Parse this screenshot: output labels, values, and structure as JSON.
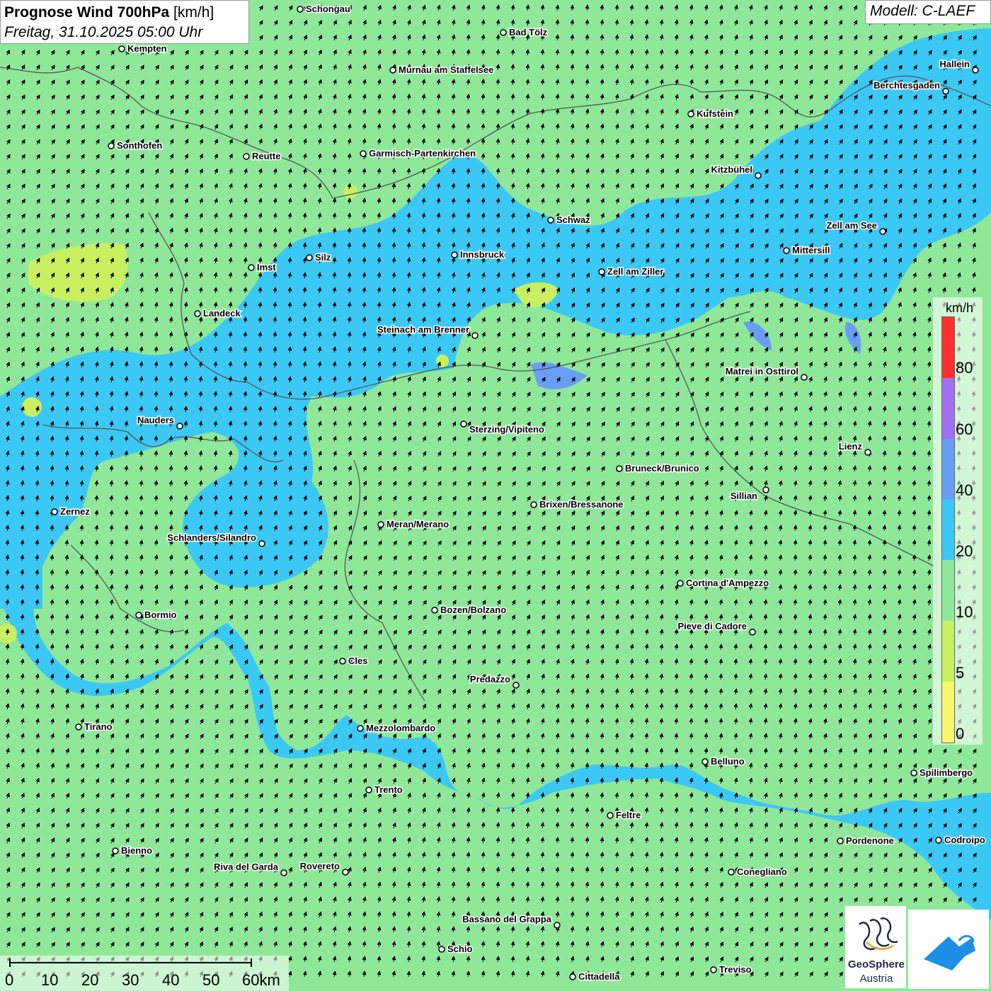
{
  "title": {
    "main": "Prognose Wind 700hPa",
    "unit": "[km/h]",
    "datetime": "Freitag, 31.10.2025 05:00 Uhr"
  },
  "model": "Modell: C-LAEF",
  "legend": {
    "unit": "km/h",
    "labels": [
      "80",
      "60",
      "40",
      "20",
      "10",
      "5",
      "0"
    ],
    "colors": [
      "#ff3030",
      "#a070f0",
      "#6a9ef5",
      "#3cc8f5",
      "#8fe89a",
      "#c8f060",
      "#f8f870"
    ]
  },
  "scale": {
    "labels": [
      "0",
      "10",
      "20",
      "30",
      "40",
      "50",
      "60km"
    ]
  },
  "logo": {
    "name": "GeoSphere",
    "sub": "Austria"
  },
  "wind": {
    "direction": "south-southwest to north-northeast",
    "dominant_speed_band": "10-20 km/h over the Alps"
  },
  "cities": [
    {
      "name": "Schongau"
    },
    {
      "name": "Bad Tölz"
    },
    {
      "name": "Kempten"
    },
    {
      "name": "Murnau am Staffelsee"
    },
    {
      "name": "Hallein"
    },
    {
      "name": "Berchtesgaden"
    },
    {
      "name": "Kufstein"
    },
    {
      "name": "Sonthofen"
    },
    {
      "name": "Reutte"
    },
    {
      "name": "Garmisch-Partenkirchen"
    },
    {
      "name": "Kitzbühel"
    },
    {
      "name": "Schwaz"
    },
    {
      "name": "Zell am See"
    },
    {
      "name": "Mittersill"
    },
    {
      "name": "Imst"
    },
    {
      "name": "Silz"
    },
    {
      "name": "Innsbruck"
    },
    {
      "name": "Zell am Ziller"
    },
    {
      "name": "Landeck"
    },
    {
      "name": "Steinach am Brenner"
    },
    {
      "name": "Matrei in Osttirol"
    },
    {
      "name": "Nauders"
    },
    {
      "name": "Sterzing/Vipiteno"
    },
    {
      "name": "Lienz"
    },
    {
      "name": "Bruneck/Brunico"
    },
    {
      "name": "Sillian"
    },
    {
      "name": "Zernez"
    },
    {
      "name": "Brixen/Bressanone"
    },
    {
      "name": "Meran/Merano"
    },
    {
      "name": "Schlanders/Silandro"
    },
    {
      "name": "Cortina d'Ampezzo"
    },
    {
      "name": "Bozen/Bolzano"
    },
    {
      "name": "Bormio"
    },
    {
      "name": "Pieve di Cadore"
    },
    {
      "name": "Cles"
    },
    {
      "name": "Predazzo"
    },
    {
      "name": "Tirano"
    },
    {
      "name": "Mezzolombardo"
    },
    {
      "name": "Belluno"
    },
    {
      "name": "Spilimbergo"
    },
    {
      "name": "Trento"
    },
    {
      "name": "Feltre"
    },
    {
      "name": "Pordenone"
    },
    {
      "name": "Codroipo"
    },
    {
      "name": "Bienno"
    },
    {
      "name": "Riva del Garda"
    },
    {
      "name": "Rovereto"
    },
    {
      "name": "Conegliano"
    },
    {
      "name": "Bassano del Grappa"
    },
    {
      "name": "Schio"
    },
    {
      "name": "Treviso"
    },
    {
      "name": "Cittadella"
    }
  ]
}
